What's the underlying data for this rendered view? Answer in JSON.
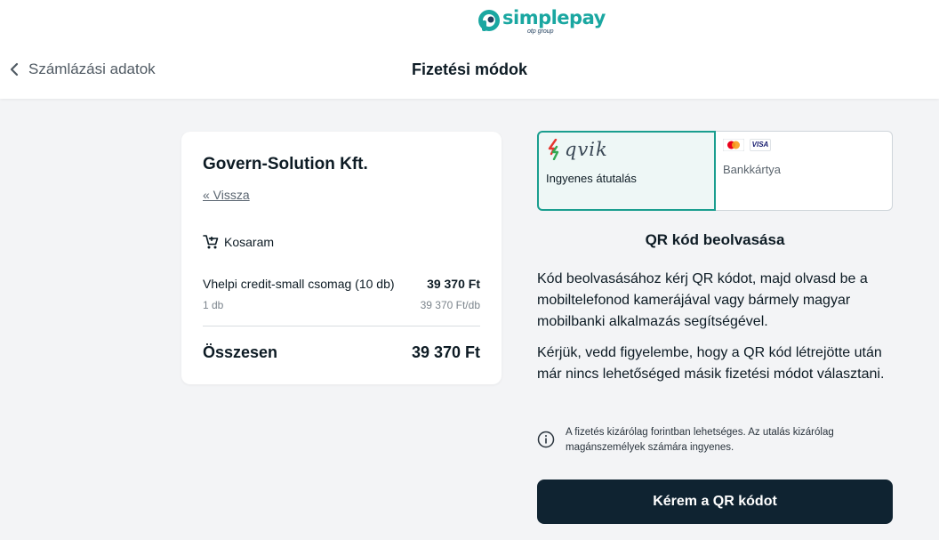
{
  "brand": {
    "name": "simplepay",
    "subtitle": "otp group",
    "color": "#1aa7a1"
  },
  "header": {
    "back_label": "Számlázási adatok",
    "title": "Fizetési módok"
  },
  "cart": {
    "merchant": "Govern-Solution Kft.",
    "back_link": "« Vissza",
    "section_label": "Kosaram",
    "item": {
      "name": "Vhelpi credit-small csomag (10 db)",
      "price": "39 370 Ft",
      "quantity": "1 db",
      "unit_price": "39 370 Ft/db"
    },
    "total_label": "Összesen",
    "total_value": "39 370 Ft"
  },
  "payment_tabs": [
    {
      "id": "qvik",
      "logo_text": "qvik",
      "label": "Ingyenes átutalás",
      "selected": true
    },
    {
      "id": "card",
      "logo_text": "VISA",
      "label": "Bankkártya",
      "selected": false
    }
  ],
  "qr": {
    "title": "QR kód beolvasása",
    "paragraph1": "Kód beolvasásához kérj QR kódot, majd olvasd be a mobiltelefonod kamerájával vagy bármely magyar mobilbanki alkalmazás segítségével.",
    "paragraph2": "Kérjük, vedd figyelembe, hogy a QR kód létrejötte után már nincs lehetőséged másik fizetési módot választani.",
    "note": "A fizetés kizárólag forintban lehetséges. Az utalás kizárólag magánszemélyek számára ingyenes.",
    "button_label": "Kérem a QR kódot"
  },
  "colors": {
    "accent": "#1a9e8f",
    "button_bg": "#0f2331",
    "page_bg": "#f3f4f6"
  }
}
